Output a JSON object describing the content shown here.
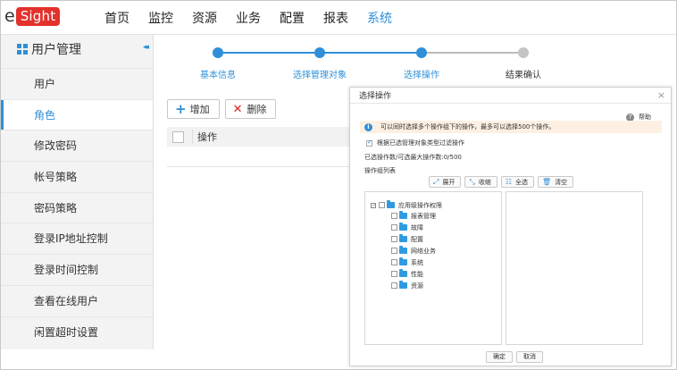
{
  "logo": {
    "prefix": "e",
    "box": "Sight"
  },
  "nav": [
    "首页",
    "监控",
    "资源",
    "业务",
    "配置",
    "报表",
    "系统"
  ],
  "sidebar": {
    "title": "用户管理",
    "collapse": "◂◂",
    "items": [
      "用户",
      "角色",
      "修改密码",
      "帐号策略",
      "密码策略",
      "登录IP地址控制",
      "登录时间控制",
      "查看在线用户",
      "闲置超时设置"
    ]
  },
  "steps": [
    {
      "label": "基本信息",
      "done": true
    },
    {
      "label": "选择管理对象",
      "done": true
    },
    {
      "label": "选择操作",
      "done": true
    },
    {
      "label": "结果确认",
      "done": false
    }
  ],
  "toolbar": {
    "add": "增加",
    "delete": "删除"
  },
  "table": {
    "col_operation": "操作"
  },
  "dialog": {
    "title": "选择操作",
    "close": "×",
    "help": "帮助",
    "info": "可以同时选择多个操作组下的操作，最多可以选择500个操作。",
    "filter_label": "根据已选管理对象类型过滤操作",
    "count": "已选操作数/可选最大操作数:0/500",
    "group_label": "操作组列表",
    "actions": [
      "展开",
      "收缩",
      "全选",
      "清空"
    ],
    "tree_root": "应用级操作权限",
    "tree_children": [
      "报表管理",
      "故障",
      "配置",
      "网络业务",
      "系统",
      "性能",
      "资源"
    ],
    "ok": "确定",
    "cancel": "取消"
  },
  "colors": {
    "accent": "#2f8fd8",
    "logo_red": "#e3312b",
    "info_bg": "#fdf0e3"
  },
  "icons": {
    "grid": "grid-icon",
    "add": "plus-icon",
    "delete": "x-icon",
    "help": "help-icon",
    "info": "info-icon",
    "folder": "folder-icon"
  }
}
